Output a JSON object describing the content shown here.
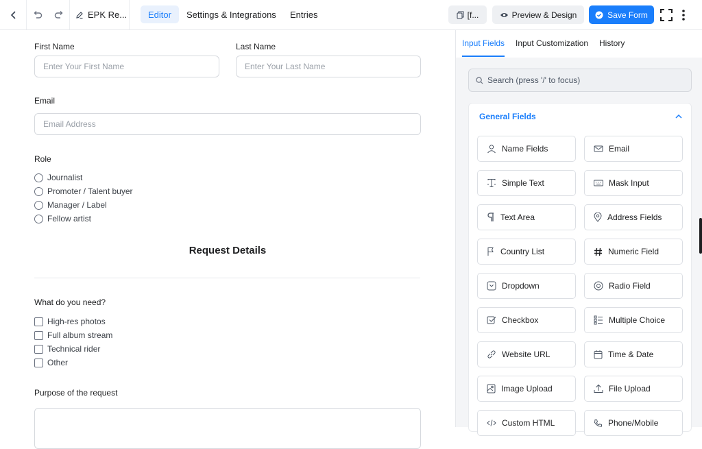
{
  "topbar": {
    "form_title": "EPK Re...",
    "tabs": [
      "Editor",
      "Settings & Integrations",
      "Entries"
    ],
    "shortcode_label": "[f...",
    "preview_label": "Preview & Design",
    "save_label": "Save Form"
  },
  "form": {
    "first_name": {
      "label": "First Name",
      "placeholder": "Enter Your First Name"
    },
    "last_name": {
      "label": "Last Name",
      "placeholder": "Enter Your Last Name"
    },
    "email": {
      "label": "Email",
      "placeholder": "Email Address"
    },
    "role": {
      "label": "Role",
      "options": [
        "Journalist",
        "Promoter / Talent buyer",
        "Manager / Label",
        "Fellow artist"
      ]
    },
    "section_title": "Request Details",
    "needs": {
      "label": "What do you need?",
      "options": [
        "High-res photos",
        "Full album stream",
        "Technical rider",
        "Other"
      ]
    },
    "purpose": {
      "label": "Purpose of the request"
    }
  },
  "panel": {
    "tabs": [
      "Input Fields",
      "Input Customization",
      "History"
    ],
    "search_placeholder": "Search (press '/' to focus)",
    "group_title": "General Fields",
    "fields": [
      {
        "label": "Name Fields",
        "icon": "user-icon"
      },
      {
        "label": "Email",
        "icon": "envelope-icon"
      },
      {
        "label": "Simple Text",
        "icon": "text-cursor-icon"
      },
      {
        "label": "Mask Input",
        "icon": "keyboard-icon"
      },
      {
        "label": "Text Area",
        "icon": "paragraph-icon"
      },
      {
        "label": "Address Fields",
        "icon": "location-pin-icon"
      },
      {
        "label": "Country List",
        "icon": "flag-icon"
      },
      {
        "label": "Numeric Field",
        "icon": "hash-icon"
      },
      {
        "label": "Dropdown",
        "icon": "dropdown-icon"
      },
      {
        "label": "Radio Field",
        "icon": "radio-icon"
      },
      {
        "label": "Checkbox",
        "icon": "checkbox-icon"
      },
      {
        "label": "Multiple Choice",
        "icon": "list-icon"
      },
      {
        "label": "Website URL",
        "icon": "link-icon"
      },
      {
        "label": "Time & Date",
        "icon": "calendar-icon"
      },
      {
        "label": "Image Upload",
        "icon": "image-icon"
      },
      {
        "label": "File Upload",
        "icon": "upload-icon"
      },
      {
        "label": "Custom HTML",
        "icon": "code-icon"
      },
      {
        "label": "Phone/Mobile",
        "icon": "phone-icon"
      }
    ]
  },
  "colors": {
    "accent": "#1a7efb",
    "panel_bg": "#f4f5f7",
    "border": "#d6d9de"
  }
}
